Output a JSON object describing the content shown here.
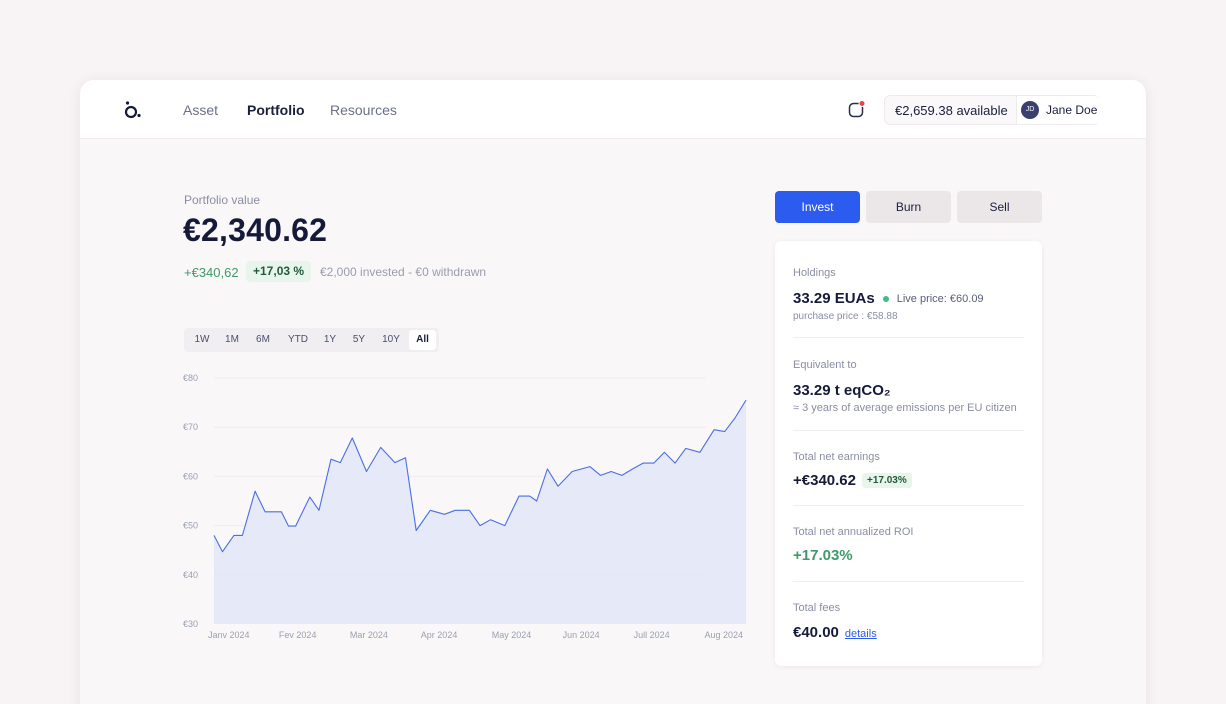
{
  "nav": {
    "links": [
      "Asset",
      "Portfolio",
      "Resources"
    ],
    "active": "Portfolio",
    "balance": "€2,659.38 available",
    "user_initials": "JD",
    "user_name": "Jane Doe"
  },
  "portfolio": {
    "label": "Portfolio value",
    "value": "€2,340.62",
    "gain": "+€340,62",
    "gain_pct": "+17,03 %",
    "note": "€2,000 invested - €0 withdrawn"
  },
  "periods": [
    "1W",
    "1M",
    "6M",
    "YTD",
    "1Y",
    "5Y",
    "10Y",
    "All"
  ],
  "active_period": "All",
  "actions": {
    "invest": "Invest",
    "burn": "Burn",
    "sell": "Sell"
  },
  "summary": {
    "holdings_label": "Holdings",
    "holdings_value": "33.29 EUAs",
    "live_price": "Live price: €60.09",
    "purchase_price": "purchase price : €58.88",
    "equivalent_label": "Equivalent to",
    "equivalent_value": "33.29 t eqCO₂",
    "equivalent_note": "≈ 3 years of average emissions per EU citizen",
    "earnings_label": "Total net earnings",
    "earnings_value": "+€340.62",
    "earnings_pct": "+17.03%",
    "roi_label": "Total net annualized ROI",
    "roi_value": "+17.03%",
    "fees_label": "Total fees",
    "fees_value": "€40.00",
    "fees_link": "details"
  },
  "colors": {
    "accent": "#2c5bf0",
    "positive": "#3f9a6b",
    "line": "#4a6fe3",
    "area": "#e3e6f8"
  },
  "chart_data": {
    "type": "area",
    "x_ticks": [
      "Janv 2024",
      "Fev 2024",
      "Mar 2024",
      "Apr 2024",
      "May 2024",
      "Jun 2024",
      "Jull 2024",
      "Aug 2024"
    ],
    "y_ticks": [
      "€80",
      "€70",
      "€60",
      "€50",
      "€40",
      "€30"
    ],
    "ylim": [
      30,
      80
    ],
    "x_range": [
      0,
      7.5
    ],
    "grid": true,
    "series": [
      {
        "x": [
          0,
          0.12,
          0.28,
          0.4,
          0.58,
          0.72,
          0.95,
          1.05,
          1.15,
          1.35,
          1.48,
          1.65,
          1.78,
          1.95,
          2.15,
          2.35,
          2.55,
          2.7,
          2.85,
          3.05,
          3.25,
          3.4,
          3.6,
          3.75,
          3.9,
          4.1,
          4.3,
          4.45,
          4.55,
          4.7,
          4.85,
          5.05,
          5.3,
          5.45,
          5.6,
          5.75,
          5.9,
          6.05,
          6.2,
          6.35,
          6.5,
          6.65,
          6.85,
          7.05,
          7.2,
          7.35,
          7.5
        ],
        "y": [
          48,
          44.7,
          48,
          48,
          57,
          52.8,
          52.8,
          49.9,
          49.9,
          55.8,
          53.1,
          63.5,
          62.8,
          67.8,
          61,
          65.9,
          62.8,
          63.8,
          49,
          53.1,
          52.3,
          53.1,
          53.1,
          50,
          51.2,
          50,
          56,
          56,
          55,
          61.5,
          58,
          61,
          62,
          60.2,
          61,
          60.2,
          61.5,
          62.7,
          62.7,
          64.9,
          62.7,
          65.7,
          64.9,
          69.5,
          69.1,
          72,
          75.5
        ]
      }
    ]
  }
}
